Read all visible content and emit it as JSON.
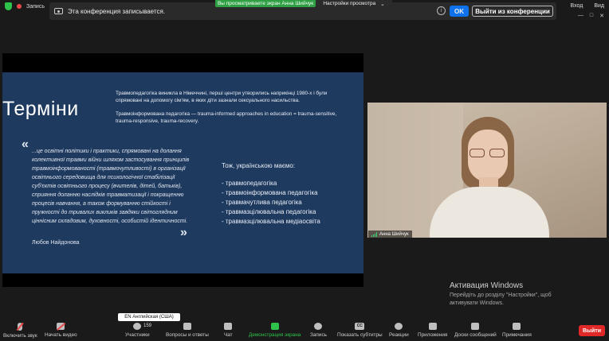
{
  "topbar": {
    "recording_label": "Запись",
    "viewing_banner": "Вы просматриваете экран Анна Шийчук",
    "view_options": "Настройки просмотра",
    "notice_text": "Эта конференция записывается.",
    "ok_label": "OK",
    "leave_label": "Выйти из конференции",
    "login_label": "Вход",
    "view_label": "Вид"
  },
  "slide": {
    "title": "Терміни",
    "p1": "Травмопедагогіка виникла в Німеччині, перші центри утворились наприкінці 1980-х і були спрямовані на допомогу сім'ям, в яких діти зазнали сексуального насильства.",
    "p2": "Травмоінформована педагогіка — trauma-informed approaches in education = trauma-sensitive, trauma-responsive, trauma-recovery.",
    "quote_open": "«",
    "quote": "...це освітні політики і практики, спрямовані на долання колективної травми війни шляхом застосування принципів травмоінформованості (травмочутливості) в організації освітнього середовища для психологічної стабілізації суб'єктів освітнього процесу (вчителів, дітей, батьків), сприяння доланню наслідків травматизації і покращенню процесів навчання, а також формуванню стійкості і пружності до тривалих викликів завдяки світоглядним ціннісним складовим, духовності, особистій ідентичності.",
    "quote_close": "»",
    "author": "Любов Найдонова",
    "ua_heading": "Тож, українською маємо:",
    "ua_items": [
      "- травмопедагогіка",
      "- травмоінформована педагогіка",
      "- травмачутлива педагогіка",
      "- травмазцілювальна педагогіка",
      "- травмазцілювальна медіаосвіта"
    ]
  },
  "video": {
    "participant_name": "Анна Шийчук"
  },
  "windows": {
    "title": "Активация Windows",
    "text": "Перейдіть до розділу \"Настройки\", щоб активувати Windows."
  },
  "toolbar": {
    "audio": "Включить звук",
    "video": "Начать видео",
    "participants": "Участники",
    "participants_count": "159",
    "qa": "Вопросы и ответы",
    "chat": "Чат",
    "share": "Демонстрация экрана",
    "record": "Запись",
    "subtitles": "Показать субтитры",
    "reactions": "Реакции",
    "apps": "Приложения",
    "whiteboard": "Доски сообщений",
    "notes": "Примечания",
    "exit": "Выйти",
    "language_popup": "EN Английская (США)",
    "cc_glyph": "CC"
  },
  "colors": {
    "slide_bg": "#1f3a5f",
    "accent_blue": "#0e72ed",
    "share_green": "#2ec24a",
    "exit_red": "#e02828"
  }
}
